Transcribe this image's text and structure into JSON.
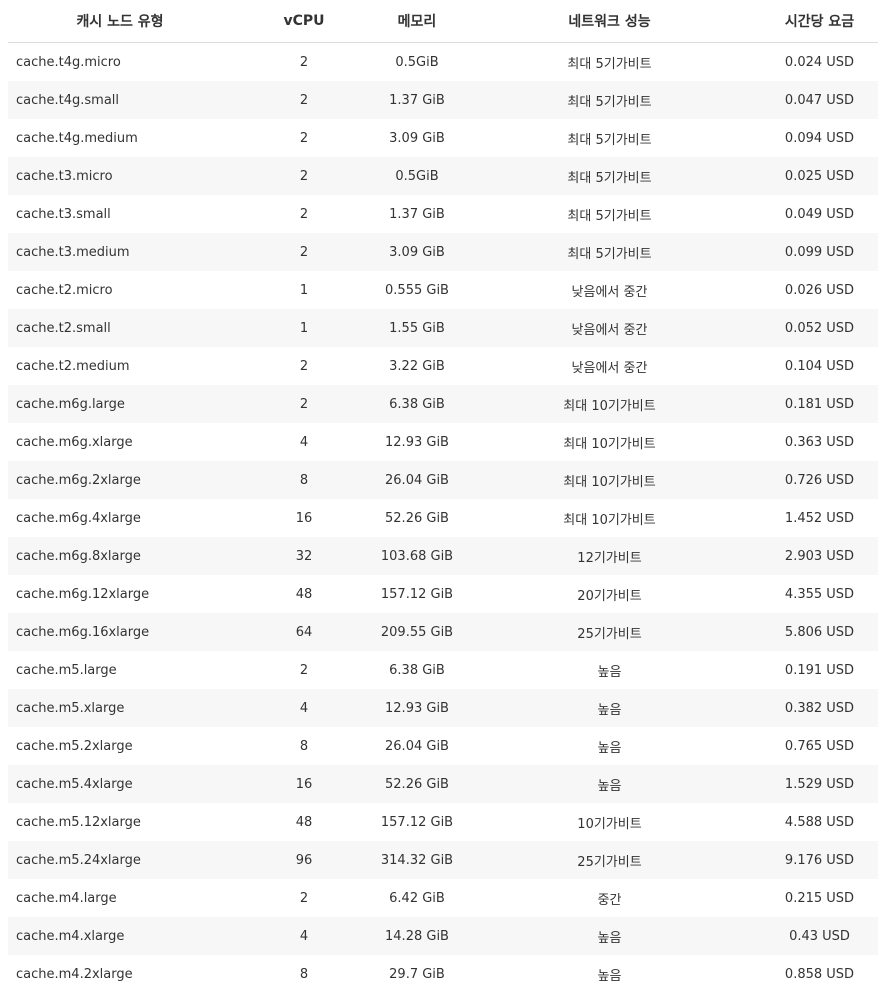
{
  "table": {
    "headers": {
      "node_type": "캐시 노드 유형",
      "vcpu": "vCPU",
      "memory": "메모리",
      "network": "네트워크 성능",
      "price": "시간당 요금"
    },
    "rows": [
      {
        "name": "cache.t4g.micro",
        "vcpu": "2",
        "memory": "0.5GiB",
        "network": "최대 5기가비트",
        "price": "0.024 USD"
      },
      {
        "name": "cache.t4g.small",
        "vcpu": "2",
        "memory": "1.37 GiB",
        "network": "최대 5기가비트",
        "price": "0.047 USD"
      },
      {
        "name": "cache.t4g.medium",
        "vcpu": "2",
        "memory": "3.09 GiB",
        "network": "최대 5기가비트",
        "price": "0.094 USD"
      },
      {
        "name": "cache.t3.micro",
        "vcpu": "2",
        "memory": "0.5GiB",
        "network": "최대 5기가비트",
        "price": "0.025 USD"
      },
      {
        "name": "cache.t3.small",
        "vcpu": "2",
        "memory": "1.37 GiB",
        "network": "최대 5기가비트",
        "price": "0.049 USD"
      },
      {
        "name": "cache.t3.medium",
        "vcpu": "2",
        "memory": "3.09 GiB",
        "network": "최대 5기가비트",
        "price": "0.099 USD"
      },
      {
        "name": "cache.t2.micro",
        "vcpu": "1",
        "memory": "0.555 GiB",
        "network": "낮음에서 중간",
        "price": "0.026 USD"
      },
      {
        "name": "cache.t2.small",
        "vcpu": "1",
        "memory": "1.55 GiB",
        "network": "낮음에서 중간",
        "price": "0.052 USD"
      },
      {
        "name": "cache.t2.medium",
        "vcpu": "2",
        "memory": "3.22 GiB",
        "network": "낮음에서 중간",
        "price": "0.104 USD"
      },
      {
        "name": "cache.m6g.large",
        "vcpu": "2",
        "memory": "6.38 GiB",
        "network": "최대 10기가비트",
        "price": "0.181 USD"
      },
      {
        "name": "cache.m6g.xlarge",
        "vcpu": "4",
        "memory": "12.93 GiB",
        "network": "최대 10기가비트",
        "price": "0.363 USD"
      },
      {
        "name": "cache.m6g.2xlarge",
        "vcpu": "8",
        "memory": "26.04 GiB",
        "network": "최대 10기가비트",
        "price": "0.726 USD"
      },
      {
        "name": "cache.m6g.4xlarge",
        "vcpu": "16",
        "memory": "52.26 GiB",
        "network": "최대 10기가비트",
        "price": "1.452 USD"
      },
      {
        "name": "cache.m6g.8xlarge",
        "vcpu": "32",
        "memory": "103.68 GiB",
        "network": "12기가비트",
        "price": "2.903 USD"
      },
      {
        "name": "cache.m6g.12xlarge",
        "vcpu": "48",
        "memory": "157.12 GiB",
        "network": "20기가비트",
        "price": "4.355 USD"
      },
      {
        "name": "cache.m6g.16xlarge",
        "vcpu": "64",
        "memory": "209.55 GiB",
        "network": "25기가비트",
        "price": "5.806 USD"
      },
      {
        "name": "cache.m5.large",
        "vcpu": "2",
        "memory": "6.38 GiB",
        "network": "높음",
        "price": "0.191 USD"
      },
      {
        "name": "cache.m5.xlarge",
        "vcpu": "4",
        "memory": "12.93 GiB",
        "network": "높음",
        "price": "0.382 USD"
      },
      {
        "name": "cache.m5.2xlarge",
        "vcpu": "8",
        "memory": "26.04 GiB",
        "network": "높음",
        "price": "0.765 USD"
      },
      {
        "name": "cache.m5.4xlarge",
        "vcpu": "16",
        "memory": "52.26 GiB",
        "network": "높음",
        "price": "1.529 USD"
      },
      {
        "name": "cache.m5.12xlarge",
        "vcpu": "48",
        "memory": "157.12 GiB",
        "network": "10기가비트",
        "price": "4.588 USD"
      },
      {
        "name": "cache.m5.24xlarge",
        "vcpu": "96",
        "memory": "314.32 GiB",
        "network": "25기가비트",
        "price": "9.176 USD"
      },
      {
        "name": "cache.m4.large",
        "vcpu": "2",
        "memory": "6.42 GiB",
        "network": "중간",
        "price": "0.215 USD"
      },
      {
        "name": "cache.m4.xlarge",
        "vcpu": "4",
        "memory": "14.28 GiB",
        "network": "높음",
        "price": "0.43 USD"
      },
      {
        "name": "cache.m4.2xlarge",
        "vcpu": "8",
        "memory": "29.7 GiB",
        "network": "높음",
        "price": "0.858 USD"
      }
    ]
  }
}
